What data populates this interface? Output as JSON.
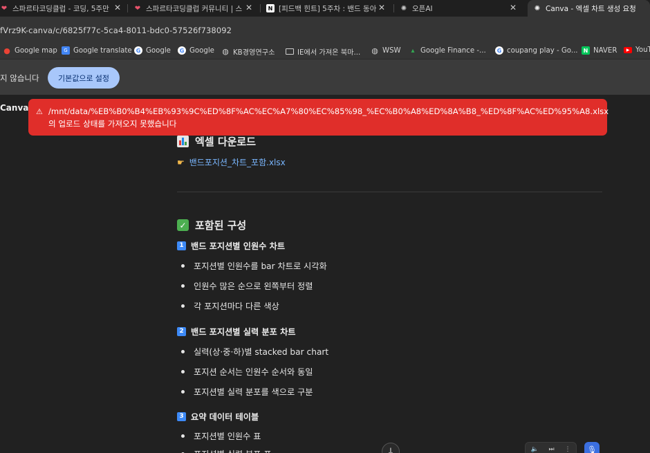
{
  "browser": {
    "tabs": [
      {
        "title": "스파르타코딩클럽 - 코딩, 5주만",
        "icon": "heart-icon",
        "color": "#e8536b"
      },
      {
        "title": "스파르타코딩클럽 커뮤니티 | 스",
        "icon": "heart-icon",
        "color": "#e8536b"
      },
      {
        "title": "[피드백 힌트] 5주차 : 밴드 동아",
        "icon": "notion-icon",
        "color": "#ffffff"
      },
      {
        "title": "오픈AI",
        "icon": "openai-icon",
        "color": "#ffffff"
      },
      {
        "title": "Canva - 엑셀 차트 생성 요청",
        "icon": "openai-icon",
        "color": "#ffffff"
      }
    ],
    "address": "fVrz9K-canva/c/6825f77c-5ca4-8011-bdc0-57526f738092",
    "bookmarks": [
      {
        "label": "Google map",
        "icon": "map-pin-icon"
      },
      {
        "label": "Google translate",
        "icon": "translate-icon"
      },
      {
        "label": "Google",
        "icon": "google-icon"
      },
      {
        "label": "Google",
        "icon": "google-icon"
      },
      {
        "label": "KB경영연구소",
        "icon": "globe-icon"
      },
      {
        "label": "IE에서 가져온 북마...",
        "icon": "folder-icon"
      },
      {
        "label": "WSW",
        "icon": "globe-icon"
      },
      {
        "label": "Google Finance -...",
        "icon": "finance-icon"
      },
      {
        "label": "coupang play - Go...",
        "icon": "google-icon"
      },
      {
        "label": "NAVER",
        "icon": "naver-icon"
      },
      {
        "label": "YouTu",
        "icon": "youtube-icon"
      }
    ]
  },
  "infobar": {
    "text": "지 않습니다",
    "button_label": "기본값으로 설정"
  },
  "app": {
    "name": "Canva"
  },
  "toast": {
    "line1": "/mnt/data/%EB%B0%B4%EB%93%9C%ED%8F%AC%EC%A7%80%EC%85%98_%EC%B0%A8%ED%8A%B8_%ED%8F%AC%ED%95%A8.xlsx",
    "line2": "의 업로드 상태를 가져오지 못했습니다"
  },
  "content": {
    "excel_heading": "엑셀 다운로드",
    "download_link": "밴드포지션_차트_포함.xlsx",
    "components_heading": "포함된 구성",
    "sections": [
      {
        "num": "1",
        "title": "밴드 포지션별 인원수 차트",
        "bullets": [
          "포지션별 인원수를 bar 차트로 시각화",
          "인원수 많은 순으로 왼쪽부터 정렬",
          "각 포지션마다 다른 색상"
        ]
      },
      {
        "num": "2",
        "title": "밴드 포지션별 실력 분포 차트",
        "bullets": [
          "실력(상·중·하)별 stacked bar chart",
          "포지션 순서는 인원수 순서와 동일",
          "포지션별 실력 분포를 색으로 구분"
        ]
      },
      {
        "num": "3",
        "title": "요약 데이터 테이블",
        "bullets": [
          "포지션별 인원수 표",
          "포지션별 실력 분포 표"
        ]
      }
    ]
  },
  "colors": {
    "toast_bg": "#e02e2a",
    "link": "#7ab7ff",
    "accent_button": "#a8c7fa"
  }
}
